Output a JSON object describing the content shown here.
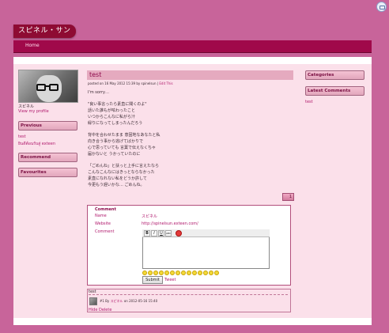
{
  "site": {
    "title": "スピネル・サン"
  },
  "nav": {
    "home": "Home"
  },
  "sidebar_left": {
    "name": "スピネル",
    "view_profile": "View my profile",
    "previous_label": "Previous",
    "previous_items": [
      "test",
      "ยินดีต้อนรับสู่ exteen"
    ],
    "recommend_label": "Recommend",
    "favourites_label": "Favourites"
  },
  "post": {
    "title": "test",
    "meta_prefix": "posted on 16 May 2012 15:39 by spinelsun",
    "meta_sep": " | ",
    "meta_edit": "Edit This",
    "lines": [
      "I'm sorry…",
      "",
      "\"良い事言ったら素直に聞くのよ\"",
      "話いた誰もが呟わったこと",
      "いつからこんなに私がら汁",
      "緑りになってしまったんだろう",
      "",
      "背中を合わせたまま 意固地なあなたと私",
      "向き合う事から逃げてばかりで",
      "心で思っていても 言葉で伝えなくちゃ",
      "届かないと うかっていたのに",
      "",
      "「ごめんね」と扶っと上手に言えたなら",
      "こんなこんなにはきっとならなかった",
      "素直になれない私をどうか許して",
      "今更もう遅いかな… ごめんね。"
    ]
  },
  "pager": {
    "page": "1"
  },
  "comment_form": {
    "header": "Comment",
    "name_label": "Name",
    "name_value": "スピネル",
    "website_label": "Website",
    "website_value": "http://spinelsun.exteen.com/",
    "comment_label": "Comment",
    "toolbar": {
      "bold": "B",
      "italic": "I",
      "underline": "U",
      "strike": "ABC"
    },
    "submit": "Submit",
    "tweet": "Tweet"
  },
  "posted_comment": {
    "title": "test",
    "meta_prefix": "#1 By",
    "meta_author": "スピネル",
    "meta_suffix": "on 2012-05-16 15:40",
    "actions": "Hide Delete"
  },
  "sidebar_right": {
    "categories_label": "Categories",
    "latest_comments_label": "Latest Comments",
    "latest_item": "test"
  },
  "colors": {
    "background": "#c8649a",
    "navbar": "#a0094a",
    "panel": "#fbe0ea",
    "link": "#b0186c"
  }
}
